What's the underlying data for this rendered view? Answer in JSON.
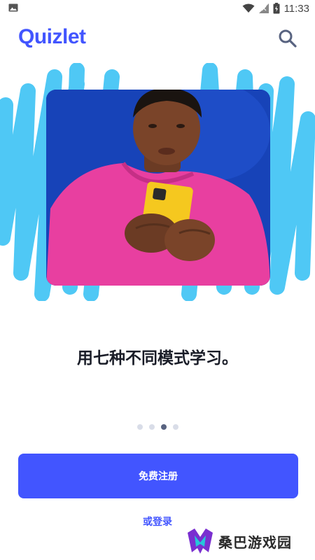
{
  "status_bar": {
    "time": "11:33",
    "icons": [
      "image-icon",
      "wifi-icon",
      "signal-icon",
      "battery-icon"
    ]
  },
  "header": {
    "logo": "Quizlet",
    "search_icon": "search-icon"
  },
  "onboarding": {
    "headline": "用七种不同模式学习。",
    "page_count": 4,
    "active_page": 3
  },
  "actions": {
    "signup_label": "免费注册",
    "login_label": "或登录"
  },
  "watermark": {
    "text": "桑巴游戏园"
  },
  "colors": {
    "brand": "#4255ff",
    "scribble": "#4fc8f5",
    "hoodie": "#e83fa0",
    "phone": "#f5c81f",
    "photo_bg": "#1743b8"
  }
}
